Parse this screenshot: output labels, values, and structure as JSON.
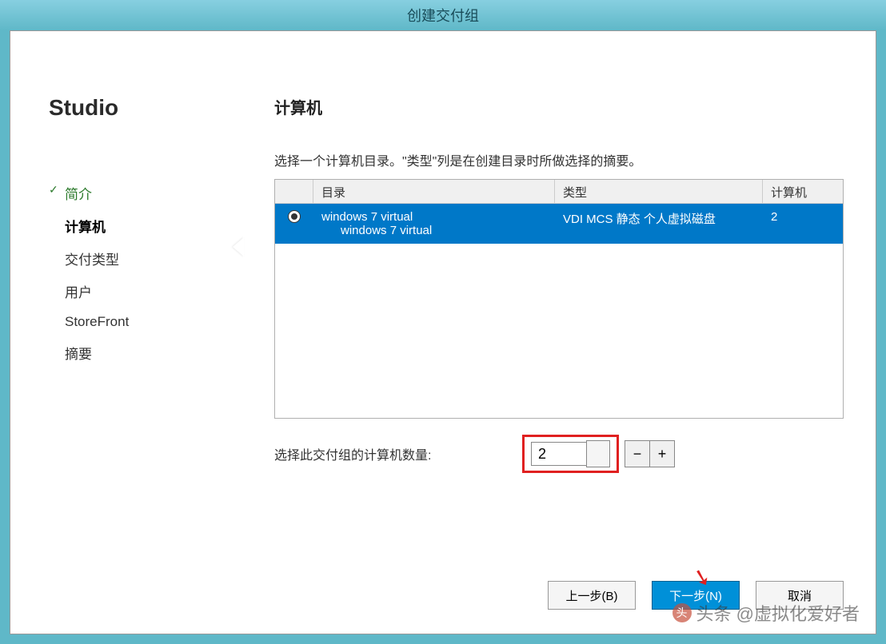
{
  "window": {
    "title": "创建交付组"
  },
  "sidebar": {
    "brand": "Studio",
    "items": [
      {
        "label": "简介",
        "state": "completed"
      },
      {
        "label": "计算机",
        "state": "active"
      },
      {
        "label": "交付类型",
        "state": "pending"
      },
      {
        "label": "用户",
        "state": "pending"
      },
      {
        "label": "StoreFront",
        "state": "pending"
      },
      {
        "label": "摘要",
        "state": "pending"
      }
    ]
  },
  "main": {
    "title": "计算机",
    "instruction": "选择一个计算机目录。\"类型\"列是在创建目录时所做选择的摘要。",
    "table": {
      "headers": {
        "catalog": "目录",
        "type": "类型",
        "machines": "计算机"
      },
      "rows": [
        {
          "selected": true,
          "catalog_name": "windows 7 virtual",
          "catalog_desc": "windows 7 virtual",
          "type": "VDI MCS 静态 个人虚拟磁盘",
          "machines": "2"
        }
      ]
    },
    "count": {
      "label": "选择此交付组的计算机数量:",
      "value": "2"
    }
  },
  "footer": {
    "back": "上一步(B)",
    "next": "下一步(N)",
    "cancel": "取消"
  },
  "watermark": {
    "text": "头条 @虚拟化爱好者"
  }
}
